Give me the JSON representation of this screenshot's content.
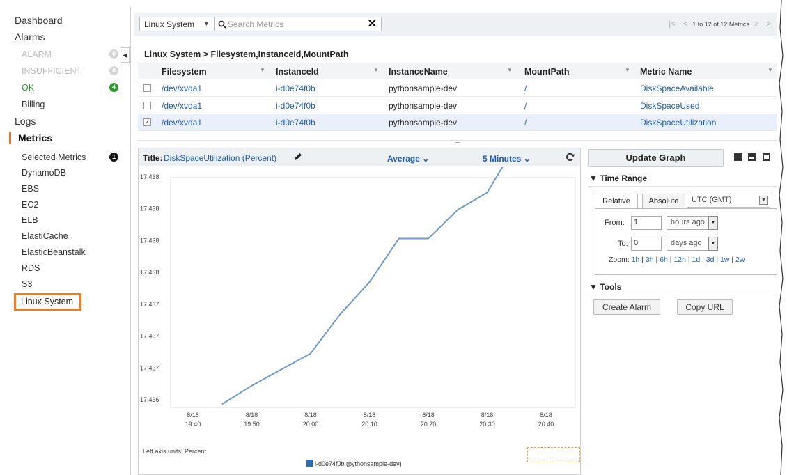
{
  "sidebar": {
    "dashboard": "Dashboard",
    "alarms": "Alarms",
    "alarm": {
      "label": "ALARM",
      "count": "0"
    },
    "insufficient": {
      "label": "INSUFFICIENT",
      "count": "0"
    },
    "ok": {
      "label": "OK",
      "count": "4"
    },
    "billing": "Billing",
    "logs": "Logs",
    "metrics": "Metrics",
    "selected_metrics": {
      "label": "Selected Metrics",
      "count": "1"
    },
    "namespaces": [
      "DynamoDB",
      "EBS",
      "EC2",
      "ELB",
      "ElastiCache",
      "ElasticBeanstalk",
      "RDS",
      "S3",
      "Linux System"
    ],
    "active_color": "#f07c1b"
  },
  "toolbar": {
    "namespace": "Linux System",
    "search_placeholder": "Search Metrics",
    "pager_text": "1 to 12 of 12 Metrics"
  },
  "table": {
    "breadcrumb": "Linux System > Filesystem,InstanceId,MountPath",
    "columns": [
      "Filesystem",
      "InstanceId",
      "InstanceName",
      "MountPath",
      "Metric Name"
    ],
    "rows": [
      {
        "checked": false,
        "filesystem": "/dev/xvda1",
        "instance_id": "i-d0e74f0b",
        "instance_name": "pythonsample-dev",
        "mount_path": "/",
        "metric": "DiskSpaceAvailable"
      },
      {
        "checked": false,
        "filesystem": "/dev/xvda1",
        "instance_id": "i-d0e74f0b",
        "instance_name": "pythonsample-dev",
        "mount_path": "/",
        "metric": "DiskSpaceUsed"
      },
      {
        "checked": true,
        "filesystem": "/dev/xvda1",
        "instance_id": "i-d0e74f0b",
        "instance_name": "pythonsample-dev",
        "mount_path": "/",
        "metric": "DiskSpaceUtilization"
      }
    ]
  },
  "graph": {
    "title_label": "Title:",
    "title_value": "DiskSpaceUtilization (Percent)",
    "statistic": "Average",
    "period": "5 Minutes",
    "units_note": "Left axis units: Percent",
    "legend": "i-d0e74f0b (pythonsample-dev)"
  },
  "chart_data": {
    "type": "line",
    "title": "DiskSpaceUtilization (Percent)",
    "ylabel": "Percent",
    "y_tick_labels": [
      "17.438",
      "17.438",
      "17.438",
      "17.438",
      "17.437",
      "17.437",
      "17.437",
      "17.436"
    ],
    "ylim": [
      17.4364,
      17.4384
    ],
    "x_tick_labels": [
      [
        "8/18",
        "19:40"
      ],
      [
        "8/18",
        "19:50"
      ],
      [
        "8/18",
        "20:00"
      ],
      [
        "8/18",
        "20:10"
      ],
      [
        "8/18",
        "20:20"
      ],
      [
        "8/18",
        "20:30"
      ],
      [
        "8/18",
        "20:40"
      ]
    ],
    "series": [
      {
        "name": "i-d0e74f0b (pythonsample-dev)",
        "color": "#6c9bd2",
        "x": [
          "19:45",
          "19:50",
          "19:55",
          "20:00",
          "20:05",
          "20:10",
          "20:15",
          "20:20",
          "20:25",
          "20:30",
          "20:35",
          "20:40"
        ],
        "y": [
          17.43643,
          17.43659,
          17.43673,
          17.43687,
          17.43721,
          17.43749,
          17.43787,
          17.43787,
          17.43812,
          17.43827,
          17.4387,
          17.4387
        ]
      }
    ]
  },
  "right_panel": {
    "update_graph": "Update Graph",
    "time_range": "Time Range",
    "tab_relative": "Relative",
    "tab_absolute": "Absolute",
    "timezone": "UTC (GMT)",
    "from_label": "From:",
    "from_value": "1",
    "from_unit": "hours ago",
    "to_label": "To:",
    "to_value": "0",
    "to_unit": "days ago",
    "zoom_label": "Zoom:",
    "zoom_options": [
      "1h",
      "3h",
      "6h",
      "12h",
      "1d",
      "3d",
      "1w",
      "2w"
    ],
    "tools": "Tools",
    "create_alarm": "Create Alarm",
    "copy_url": "Copy URL"
  }
}
